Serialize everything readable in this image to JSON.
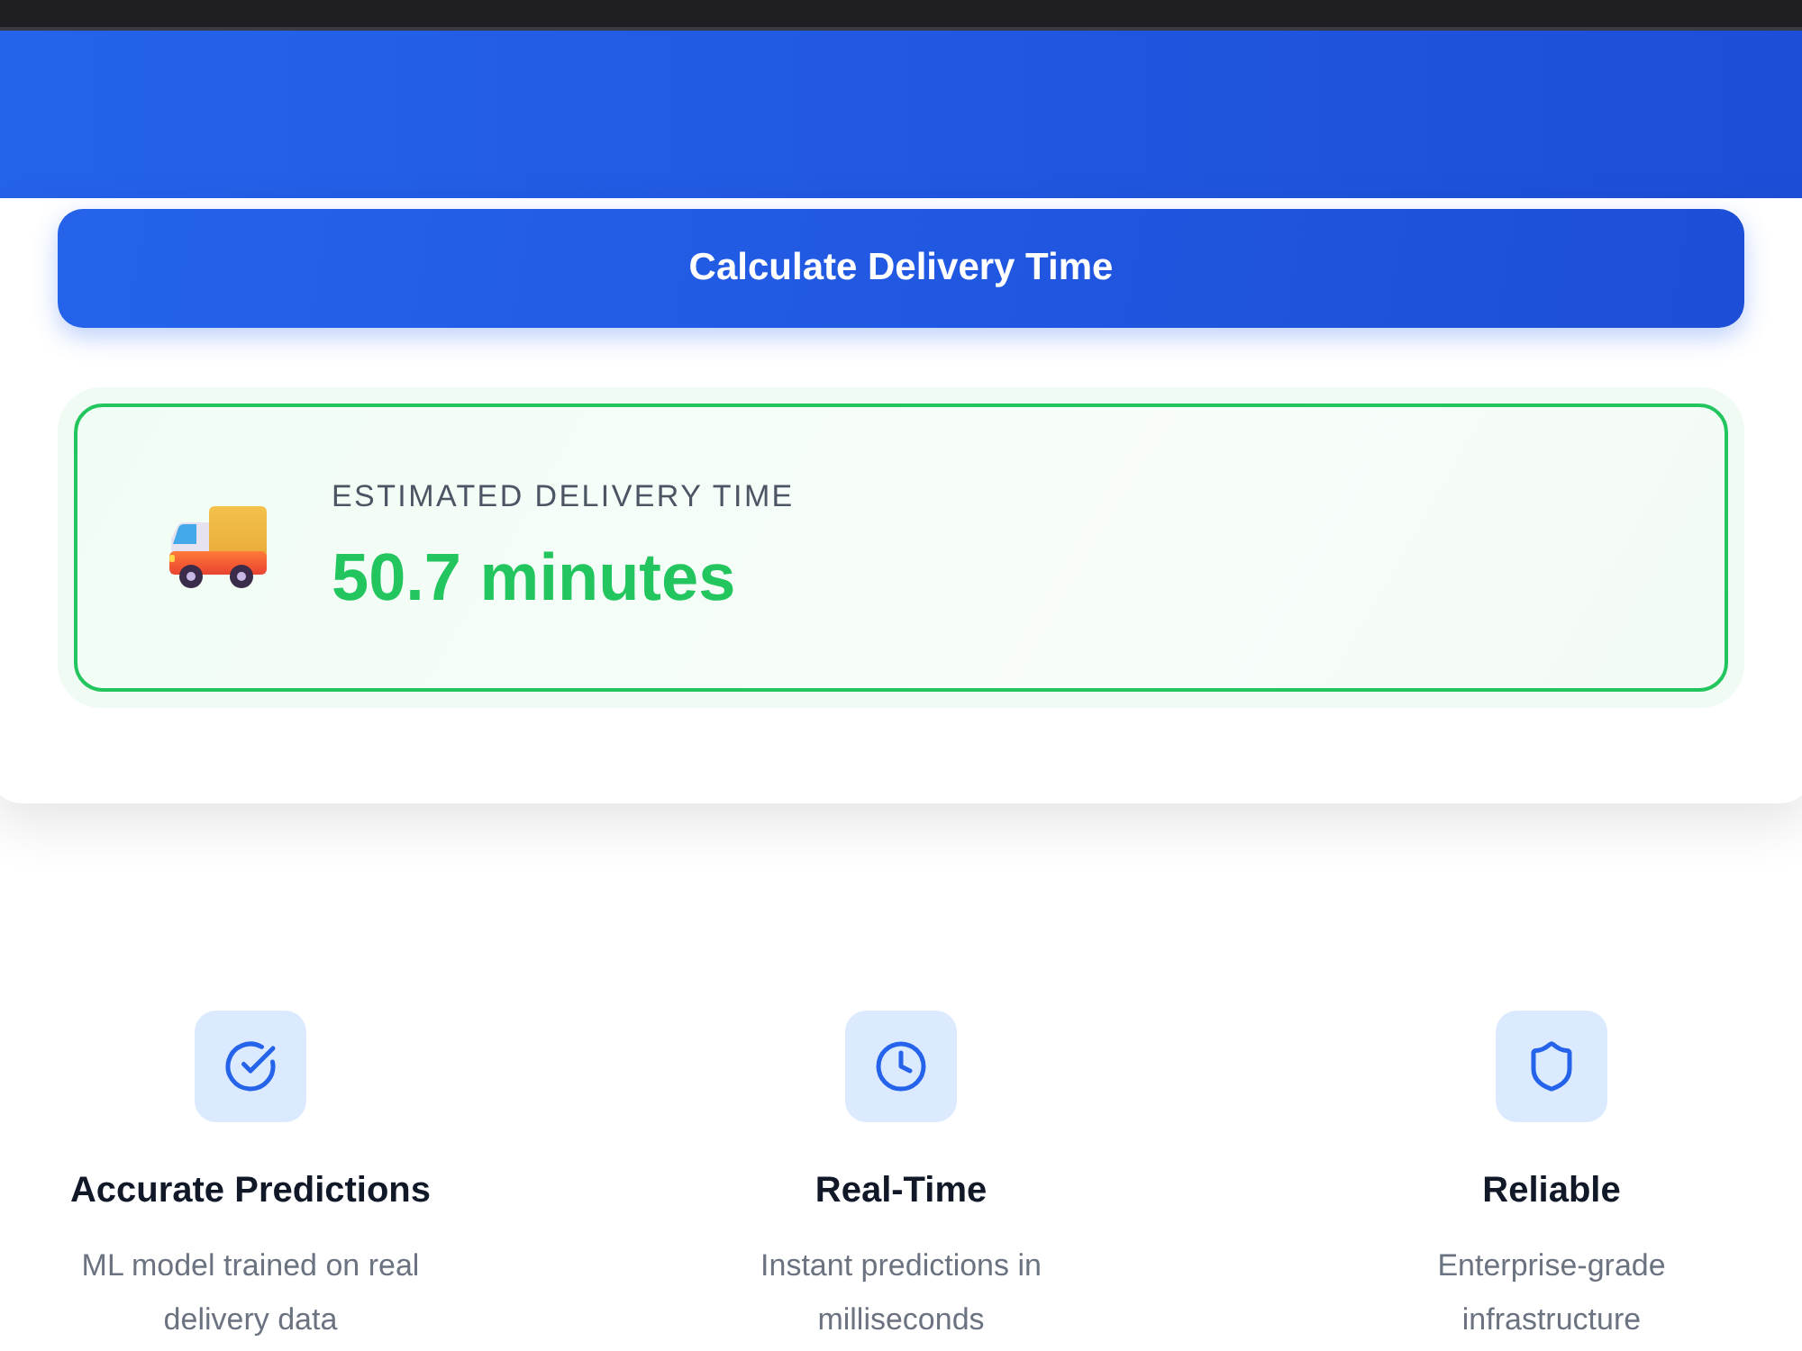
{
  "action_button": {
    "label": "Calculate Delivery Time"
  },
  "result": {
    "label": "ESTIMATED DELIVERY TIME",
    "value": "50.7 minutes"
  },
  "features": [
    {
      "kind": "check",
      "title": "Accurate Predictions",
      "description": "ML model trained on real delivery data"
    },
    {
      "kind": "clock",
      "title": "Real-Time",
      "description": "Instant predictions in milliseconds"
    },
    {
      "kind": "shield",
      "title": "Reliable",
      "description": "Enterprise-grade infrastructure"
    }
  ]
}
